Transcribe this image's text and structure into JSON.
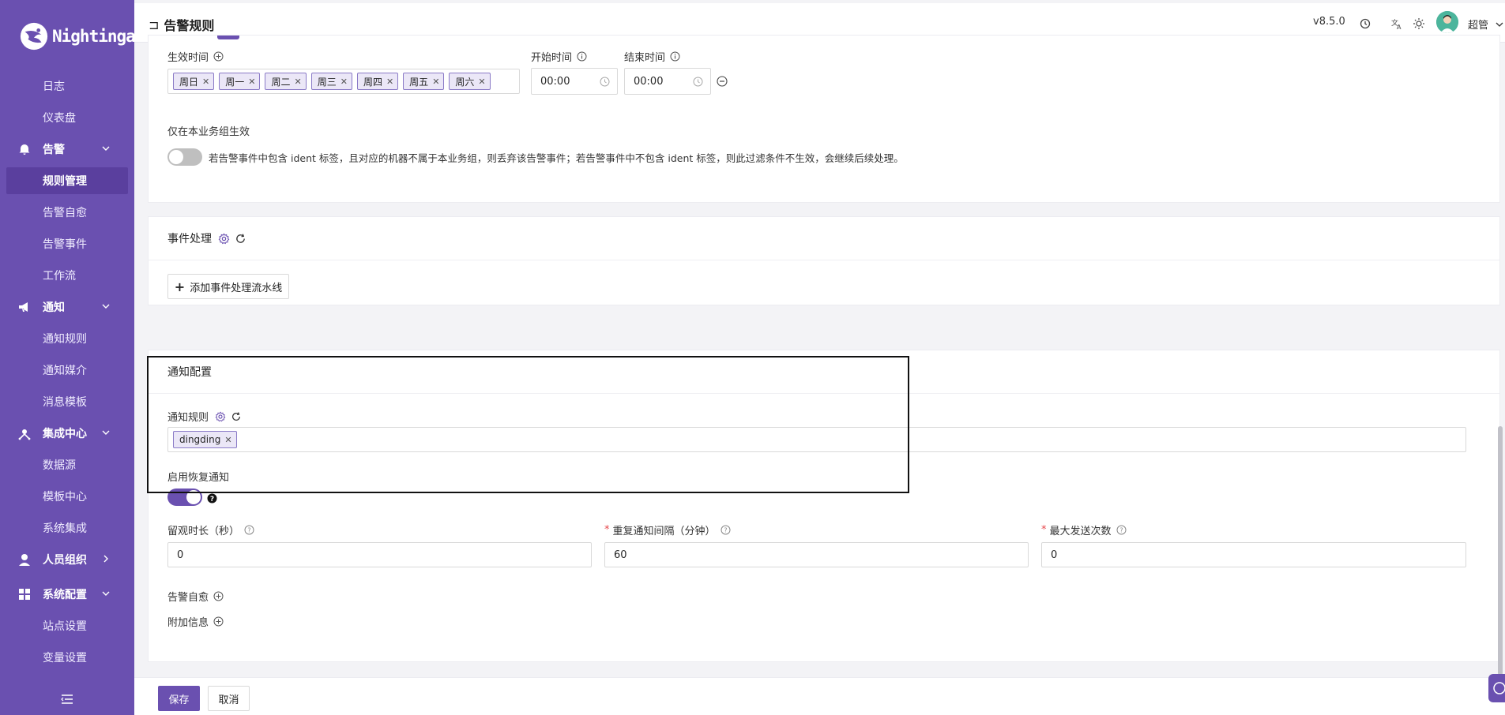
{
  "brand": {
    "name": "Nightingale",
    "accent": "#6a50b0"
  },
  "sidebar": {
    "items": [
      {
        "label": "日志",
        "type": "sub"
      },
      {
        "label": "仪表盘",
        "type": "sub"
      },
      {
        "label": "告警",
        "type": "group",
        "icon": "bell-icon"
      },
      {
        "label": "规则管理",
        "type": "sub",
        "active": true
      },
      {
        "label": "告警自愈",
        "type": "sub"
      },
      {
        "label": "告警事件",
        "type": "sub"
      },
      {
        "label": "工作流",
        "type": "sub"
      },
      {
        "label": "通知",
        "type": "group",
        "icon": "megaphone-icon"
      },
      {
        "label": "通知规则",
        "type": "sub"
      },
      {
        "label": "通知媒介",
        "type": "sub"
      },
      {
        "label": "消息模板",
        "type": "sub"
      },
      {
        "label": "集成中心",
        "type": "group",
        "icon": "integration-icon"
      },
      {
        "label": "数据源",
        "type": "sub"
      },
      {
        "label": "模板中心",
        "type": "sub"
      },
      {
        "label": "系统集成",
        "type": "sub"
      },
      {
        "label": "人员组织",
        "type": "group",
        "icon": "user-icon"
      },
      {
        "label": "系统配置",
        "type": "group",
        "icon": "grid-icon"
      },
      {
        "label": "站点设置",
        "type": "sub"
      },
      {
        "label": "变量设置",
        "type": "sub"
      }
    ]
  },
  "header": {
    "title": "告警规则",
    "version": "v8.5.0",
    "user": "超管"
  },
  "effective": {
    "time_label": "生效时间",
    "days": [
      "周日",
      "周一",
      "周二",
      "周三",
      "周四",
      "周五",
      "周六"
    ],
    "start_label": "开始时间",
    "start_value": "00:00",
    "end_label": "结束时间",
    "end_value": "00:00",
    "only_biz_label": "仅在本业务组生效",
    "only_biz_desc": "若告警事件中包含 ident 标签，且对应的机器不属于本业务组，则丢弃该告警事件；若告警事件中不包含 ident 标签，则此过滤条件不生效，会继续后续处理。",
    "only_biz_enabled": false
  },
  "event_processing": {
    "title": "事件处理",
    "add_button": "添加事件处理流水线"
  },
  "notify": {
    "title": "通知配置",
    "rule_label": "通知规则",
    "rules": [
      "dingding"
    ],
    "recovery_label": "启用恢复通知",
    "recovery_enabled": true,
    "observe_label": "留观时长（秒）",
    "observe_value": "0",
    "repeat_label": "重复通知间隔（分钟）",
    "repeat_value": "60",
    "max_label": "最大发送次数",
    "max_value": "0",
    "self_heal_label": "告警自愈",
    "extra_label": "附加信息"
  },
  "footer": {
    "save": "保存",
    "cancel": "取消"
  }
}
